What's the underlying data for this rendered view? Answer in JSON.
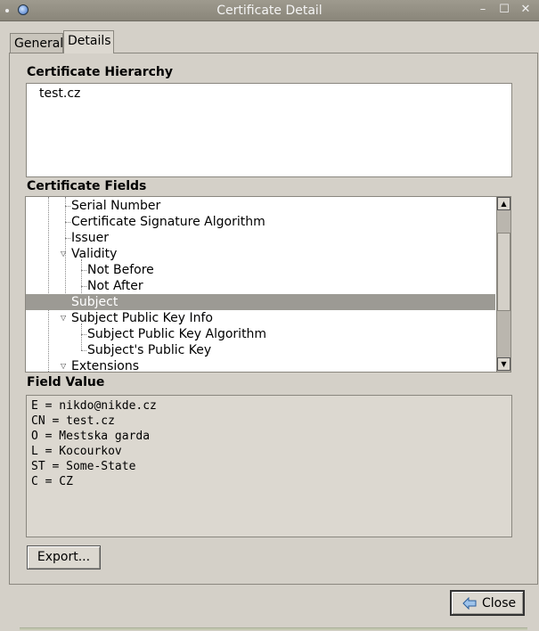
{
  "window": {
    "title": "Certificate Detail"
  },
  "tabs": [
    {
      "label": "General",
      "active": false
    },
    {
      "label": "Details",
      "active": true
    }
  ],
  "hierarchy": {
    "label": "Certificate Hierarchy",
    "items": [
      "test.cz"
    ]
  },
  "fields": {
    "label": "Certificate Fields",
    "rows": [
      {
        "label": "Serial Number",
        "depth": 1
      },
      {
        "label": "Certificate Signature Algorithm",
        "depth": 1
      },
      {
        "label": "Issuer",
        "depth": 1
      },
      {
        "label": "Validity",
        "depth": 1,
        "expanded": true
      },
      {
        "label": "Not Before",
        "depth": 2
      },
      {
        "label": "Not After",
        "depth": 2
      },
      {
        "label": "Subject",
        "depth": 1,
        "selected": true
      },
      {
        "label": "Subject Public Key Info",
        "depth": 1,
        "expanded": true
      },
      {
        "label": "Subject Public Key Algorithm",
        "depth": 2
      },
      {
        "label": "Subject's Public Key",
        "depth": 2
      },
      {
        "label": "Extensions",
        "depth": 1,
        "expanded": true
      }
    ]
  },
  "field_value": {
    "label": "Field Value",
    "lines": [
      "E = nikdo@nikde.cz",
      "CN = test.cz",
      "O = Mestska garda",
      "L = Kocourkov",
      "ST = Some-State",
      "C = CZ"
    ]
  },
  "buttons": {
    "export": "Export...",
    "close": "Close"
  },
  "icons": {
    "window_menu": "window-menu-icon",
    "app": "app-icon",
    "minimize": "minimize-icon",
    "maximize": "maximize-icon",
    "close_window": "close-window-icon",
    "close_button": "close-arrow-icon"
  },
  "colors": {
    "selection": "#9c9a94",
    "window_bg": "#d4d0c8"
  }
}
